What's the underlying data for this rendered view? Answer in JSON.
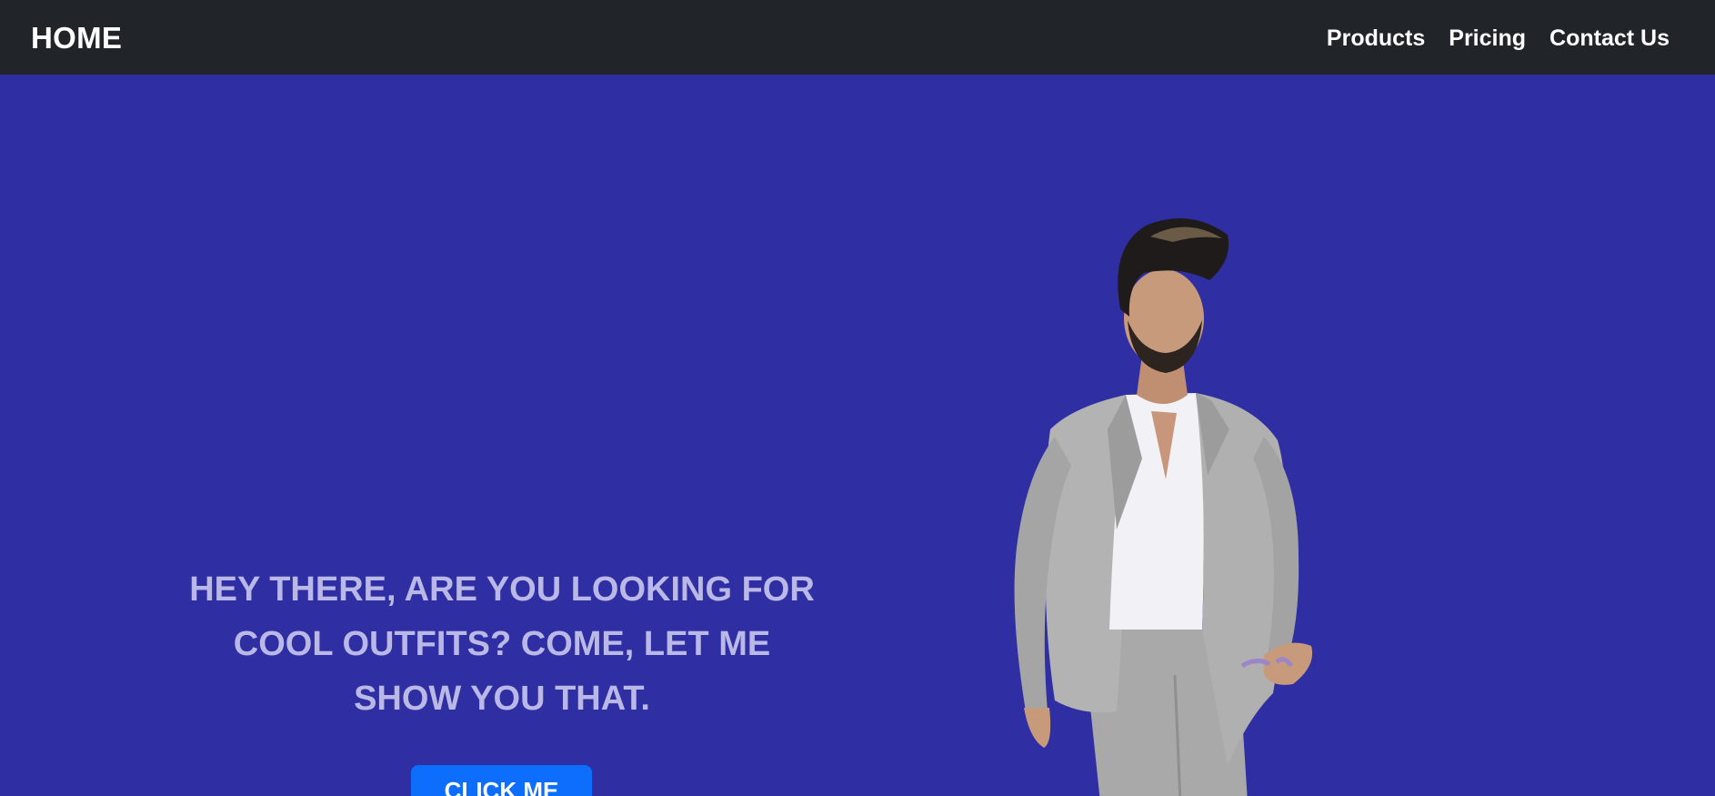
{
  "navbar": {
    "brand": "HOME",
    "links": [
      {
        "label": "Products"
      },
      {
        "label": "Pricing"
      },
      {
        "label": "Contact Us"
      }
    ]
  },
  "hero": {
    "headline": "HEY THERE, ARE YOU LOOKING FOR COOL OUTFITS? COME, LET ME SHOW YOU THAT.",
    "cta_label": "CLICK ME",
    "image_subject": "man-in-grey-suit",
    "colors": {
      "background": "#2f2ea3",
      "headline": "#b9b8e6",
      "button": "#0d6efd",
      "navbar": "#212529"
    }
  }
}
